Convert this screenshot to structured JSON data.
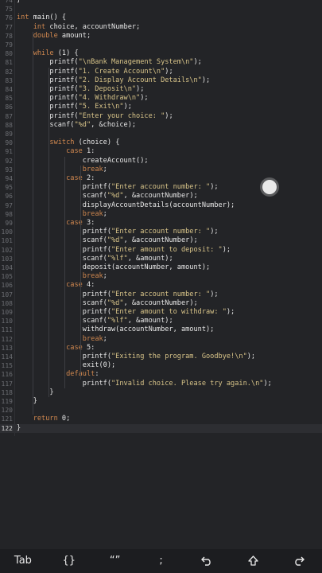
{
  "editor": {
    "current_line": "122",
    "lines": [
      {
        "n": "74",
        "c": "}"
      },
      {
        "n": "75",
        "c": ""
      },
      {
        "n": "76",
        "c": "int main() {"
      },
      {
        "n": "77",
        "c": "    int choice, accountNumber;"
      },
      {
        "n": "78",
        "c": "    double amount;"
      },
      {
        "n": "79",
        "c": ""
      },
      {
        "n": "80",
        "c": "    while (1) {"
      },
      {
        "n": "81",
        "c": "        printf(\"\\nBank Management System\\n\");"
      },
      {
        "n": "82",
        "c": "        printf(\"1. Create Account\\n\");"
      },
      {
        "n": "83",
        "c": "        printf(\"2. Display Account Details\\n\");"
      },
      {
        "n": "84",
        "c": "        printf(\"3. Deposit\\n\");"
      },
      {
        "n": "85",
        "c": "        printf(\"4. Withdraw\\n\");"
      },
      {
        "n": "86",
        "c": "        printf(\"5. Exit\\n\");"
      },
      {
        "n": "87",
        "c": "        printf(\"Enter your choice: \");"
      },
      {
        "n": "88",
        "c": "        scanf(\"%d\", &choice);"
      },
      {
        "n": "89",
        "c": ""
      },
      {
        "n": "90",
        "c": "        switch (choice) {"
      },
      {
        "n": "91",
        "c": "            case 1:"
      },
      {
        "n": "92",
        "c": "                createAccount();"
      },
      {
        "n": "93",
        "c": "                break;"
      },
      {
        "n": "94",
        "c": "            case 2:"
      },
      {
        "n": "95",
        "c": "                printf(\"Enter account number: \");"
      },
      {
        "n": "96",
        "c": "                scanf(\"%d\", &accountNumber);"
      },
      {
        "n": "97",
        "c": "                displayAccountDetails(accountNumber);"
      },
      {
        "n": "98",
        "c": "                break;"
      },
      {
        "n": "99",
        "c": "            case 3:"
      },
      {
        "n": "100",
        "c": "                printf(\"Enter account number: \");"
      },
      {
        "n": "101",
        "c": "                scanf(\"%d\", &accountNumber);"
      },
      {
        "n": "102",
        "c": "                printf(\"Enter amount to deposit: \");"
      },
      {
        "n": "103",
        "c": "                scanf(\"%lf\", &amount);"
      },
      {
        "n": "104",
        "c": "                deposit(accountNumber, amount);"
      },
      {
        "n": "105",
        "c": "                break;"
      },
      {
        "n": "106",
        "c": "            case 4:"
      },
      {
        "n": "107",
        "c": "                printf(\"Enter account number: \");"
      },
      {
        "n": "108",
        "c": "                scanf(\"%d\", &accountNumber);"
      },
      {
        "n": "109",
        "c": "                printf(\"Enter amount to withdraw: \");"
      },
      {
        "n": "110",
        "c": "                scanf(\"%lf\", &amount);"
      },
      {
        "n": "111",
        "c": "                withdraw(accountNumber, amount);"
      },
      {
        "n": "112",
        "c": "                break;"
      },
      {
        "n": "113",
        "c": "            case 5:"
      },
      {
        "n": "114",
        "c": "                printf(\"Exiting the program. Goodbye!\\n\");"
      },
      {
        "n": "115",
        "c": "                exit(0);"
      },
      {
        "n": "116",
        "c": "            default:"
      },
      {
        "n": "117",
        "c": "                printf(\"Invalid choice. Please try again.\\n\");"
      },
      {
        "n": "118",
        "c": "        }"
      },
      {
        "n": "119",
        "c": "    }"
      },
      {
        "n": "120",
        "c": ""
      },
      {
        "n": "121",
        "c": "    return 0;"
      },
      {
        "n": "122",
        "c": "}"
      }
    ]
  },
  "toolbar": {
    "tab_label": "Tab",
    "braces_label": "{}",
    "quotes_label": "“”",
    "semicolon_label": ";",
    "undo_icon": "undo-icon",
    "shift_icon": "shift-up-icon",
    "redo_icon": "redo-icon"
  },
  "colors": {
    "background": "#232427",
    "keyword": "#d1884f",
    "string": "#d8c489",
    "text": "#e6e6e6",
    "line_number": "#6b6d72"
  }
}
